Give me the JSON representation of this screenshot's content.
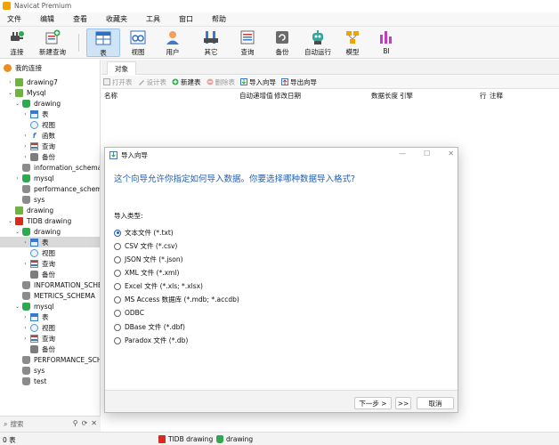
{
  "window": {
    "title": "Navicat Premium"
  },
  "menubar": {
    "items": [
      "文件",
      "编辑",
      "查看",
      "收藏夹",
      "工具",
      "窗口",
      "帮助"
    ]
  },
  "toolbar": {
    "connect": "连接",
    "new_query": "新建查询",
    "table": "表",
    "view": "视图",
    "user": "用户",
    "others": "其它",
    "query": "查询",
    "backup": "备份",
    "automation": "自动运行",
    "model": "模型",
    "bi": "BI"
  },
  "sidebar": {
    "header": "我的连接",
    "rows": [
      "drawing7",
      "Mysql",
      "drawing",
      "表",
      "视图",
      "函数",
      "查询",
      "备份",
      "information_schema",
      "mysql",
      "performance_schema",
      "sys",
      "drawing",
      "TIDB drawing",
      "drawing",
      "表",
      "视图",
      "查询",
      "备份",
      "INFORMATION_SCHEMA",
      "METRICS_SCHEMA",
      "mysql",
      "表",
      "视图",
      "查询",
      "备份",
      "PERFORMANCE_SCHEMA",
      "sys",
      "test"
    ],
    "search_placeholder": "搜索"
  },
  "main": {
    "tab": "对象",
    "objbar": {
      "open": "打开表",
      "design": "设计表",
      "new": "新建表",
      "delete": "删除表",
      "import": "导入向导",
      "export": "导出向导"
    },
    "columns": {
      "name": "名称",
      "auto_inc": "自动递增值",
      "modified": "修改日期",
      "data_len": "数据长度",
      "engine": "引擎",
      "rows": "行",
      "comment": "注释"
    }
  },
  "dialog": {
    "title": "导入向导",
    "heading": "这个向导允许你指定如何导入数据。你要选择哪种数据导入格式?",
    "import_type_label": "导入类型:",
    "options": [
      "文本文件 (*.txt)",
      "CSV 文件 (*.csv)",
      "JSON 文件 (*.json)",
      "XML 文件 (*.xml)",
      "Excel 文件 (*.xls; *.xlsx)",
      "MS Access 数据库 (*.mdb; *.accdb)",
      "ODBC",
      "DBase 文件 (*.dbf)",
      "Paradox 文件 (*.db)"
    ],
    "selected_option": "文本文件 (*.txt)",
    "next": "下一步 >",
    "last": ">>",
    "cancel": "取消"
  },
  "statusbar": {
    "count": "0 表",
    "conn1": "TIDB drawing",
    "conn2": "drawing"
  },
  "colors": {
    "accent": "#1f5fb5",
    "selected_tool": "#cfe3f7"
  }
}
